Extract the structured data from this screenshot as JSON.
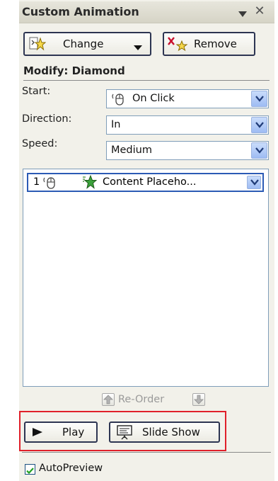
{
  "pane": {
    "title": "Custom Animation",
    "title_menu_icon": "triangle-down-icon",
    "close_icon": "close-icon"
  },
  "toolbar": {
    "change_label": "Change",
    "change_icon": "star-effects-icon",
    "remove_label": "Remove",
    "remove_icon": "remove-effect-icon"
  },
  "modify": {
    "heading": "Modify: Diamond",
    "start_label": "Start:",
    "start_value": "On Click",
    "start_icon": "mouse-icon",
    "direction_label": "Direction:",
    "direction_value": "In",
    "speed_label": "Speed:",
    "speed_value": "Medium"
  },
  "animation_list": {
    "items": [
      {
        "number": "1",
        "trigger_icon": "mouse-icon",
        "effect_icon": "green-star-icon",
        "label": "Content Placeho..."
      }
    ]
  },
  "reorder": {
    "label": "Re-Order",
    "up_icon": "arrow-up-icon",
    "down_icon": "arrow-down-icon"
  },
  "footer": {
    "play_label": "Play",
    "play_icon": "play-icon",
    "slideshow_label": "Slide Show",
    "slideshow_icon": "projector-icon",
    "autopreview_label": "AutoPreview",
    "autopreview_checked": true
  },
  "colors": {
    "pane_bg": "#f2f1ea",
    "highlight": "#e0202a",
    "selection_border": "#2c5bb5",
    "dropdown_button": "#9ebcf3"
  }
}
